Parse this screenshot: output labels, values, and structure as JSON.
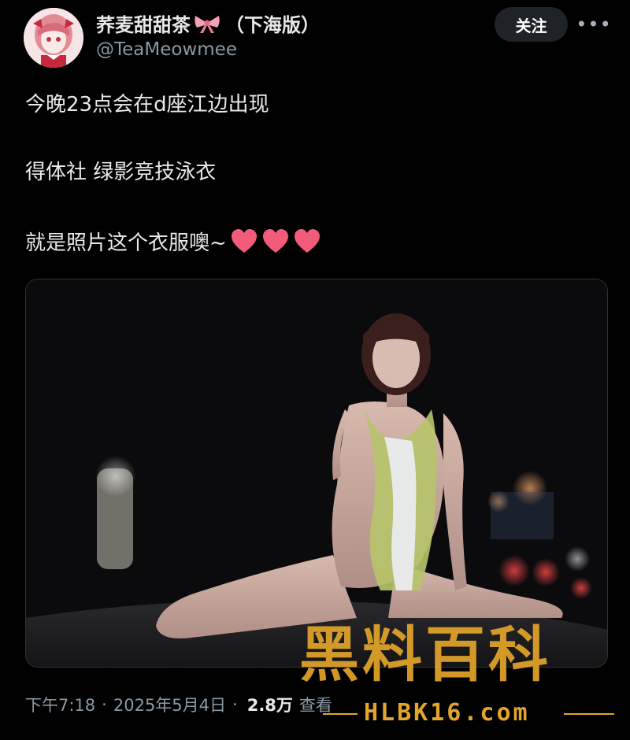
{
  "author": {
    "display_name": "荞麦甜甜茶",
    "display_name_suffix": "（下海版）",
    "handle": "@TeaMeowmee"
  },
  "actions": {
    "follow_label": "关注",
    "more_label": "•••"
  },
  "tweet": {
    "line1": "今晚23点会在d座江边出现",
    "line2": "得体社 绿影竞技泳衣",
    "line3": "就是照片这个衣服噢~"
  },
  "meta": {
    "time": "下午7:18",
    "date": "2025年5月4日",
    "views_count": "2.8万",
    "views_label": "查看"
  },
  "watermark": {
    "text": "黑料百科",
    "url": "HLBK16.com"
  },
  "icons": [
    "bow-icon",
    "heart-icon",
    "more-icon",
    "avatar"
  ],
  "colors": {
    "background": "#000000",
    "text_primary": "#e7e9ea",
    "text_secondary": "#8b98a5",
    "follow_button_bg": "#1f2328",
    "heart": "#f25c7a",
    "watermark": "#e3a52a"
  }
}
